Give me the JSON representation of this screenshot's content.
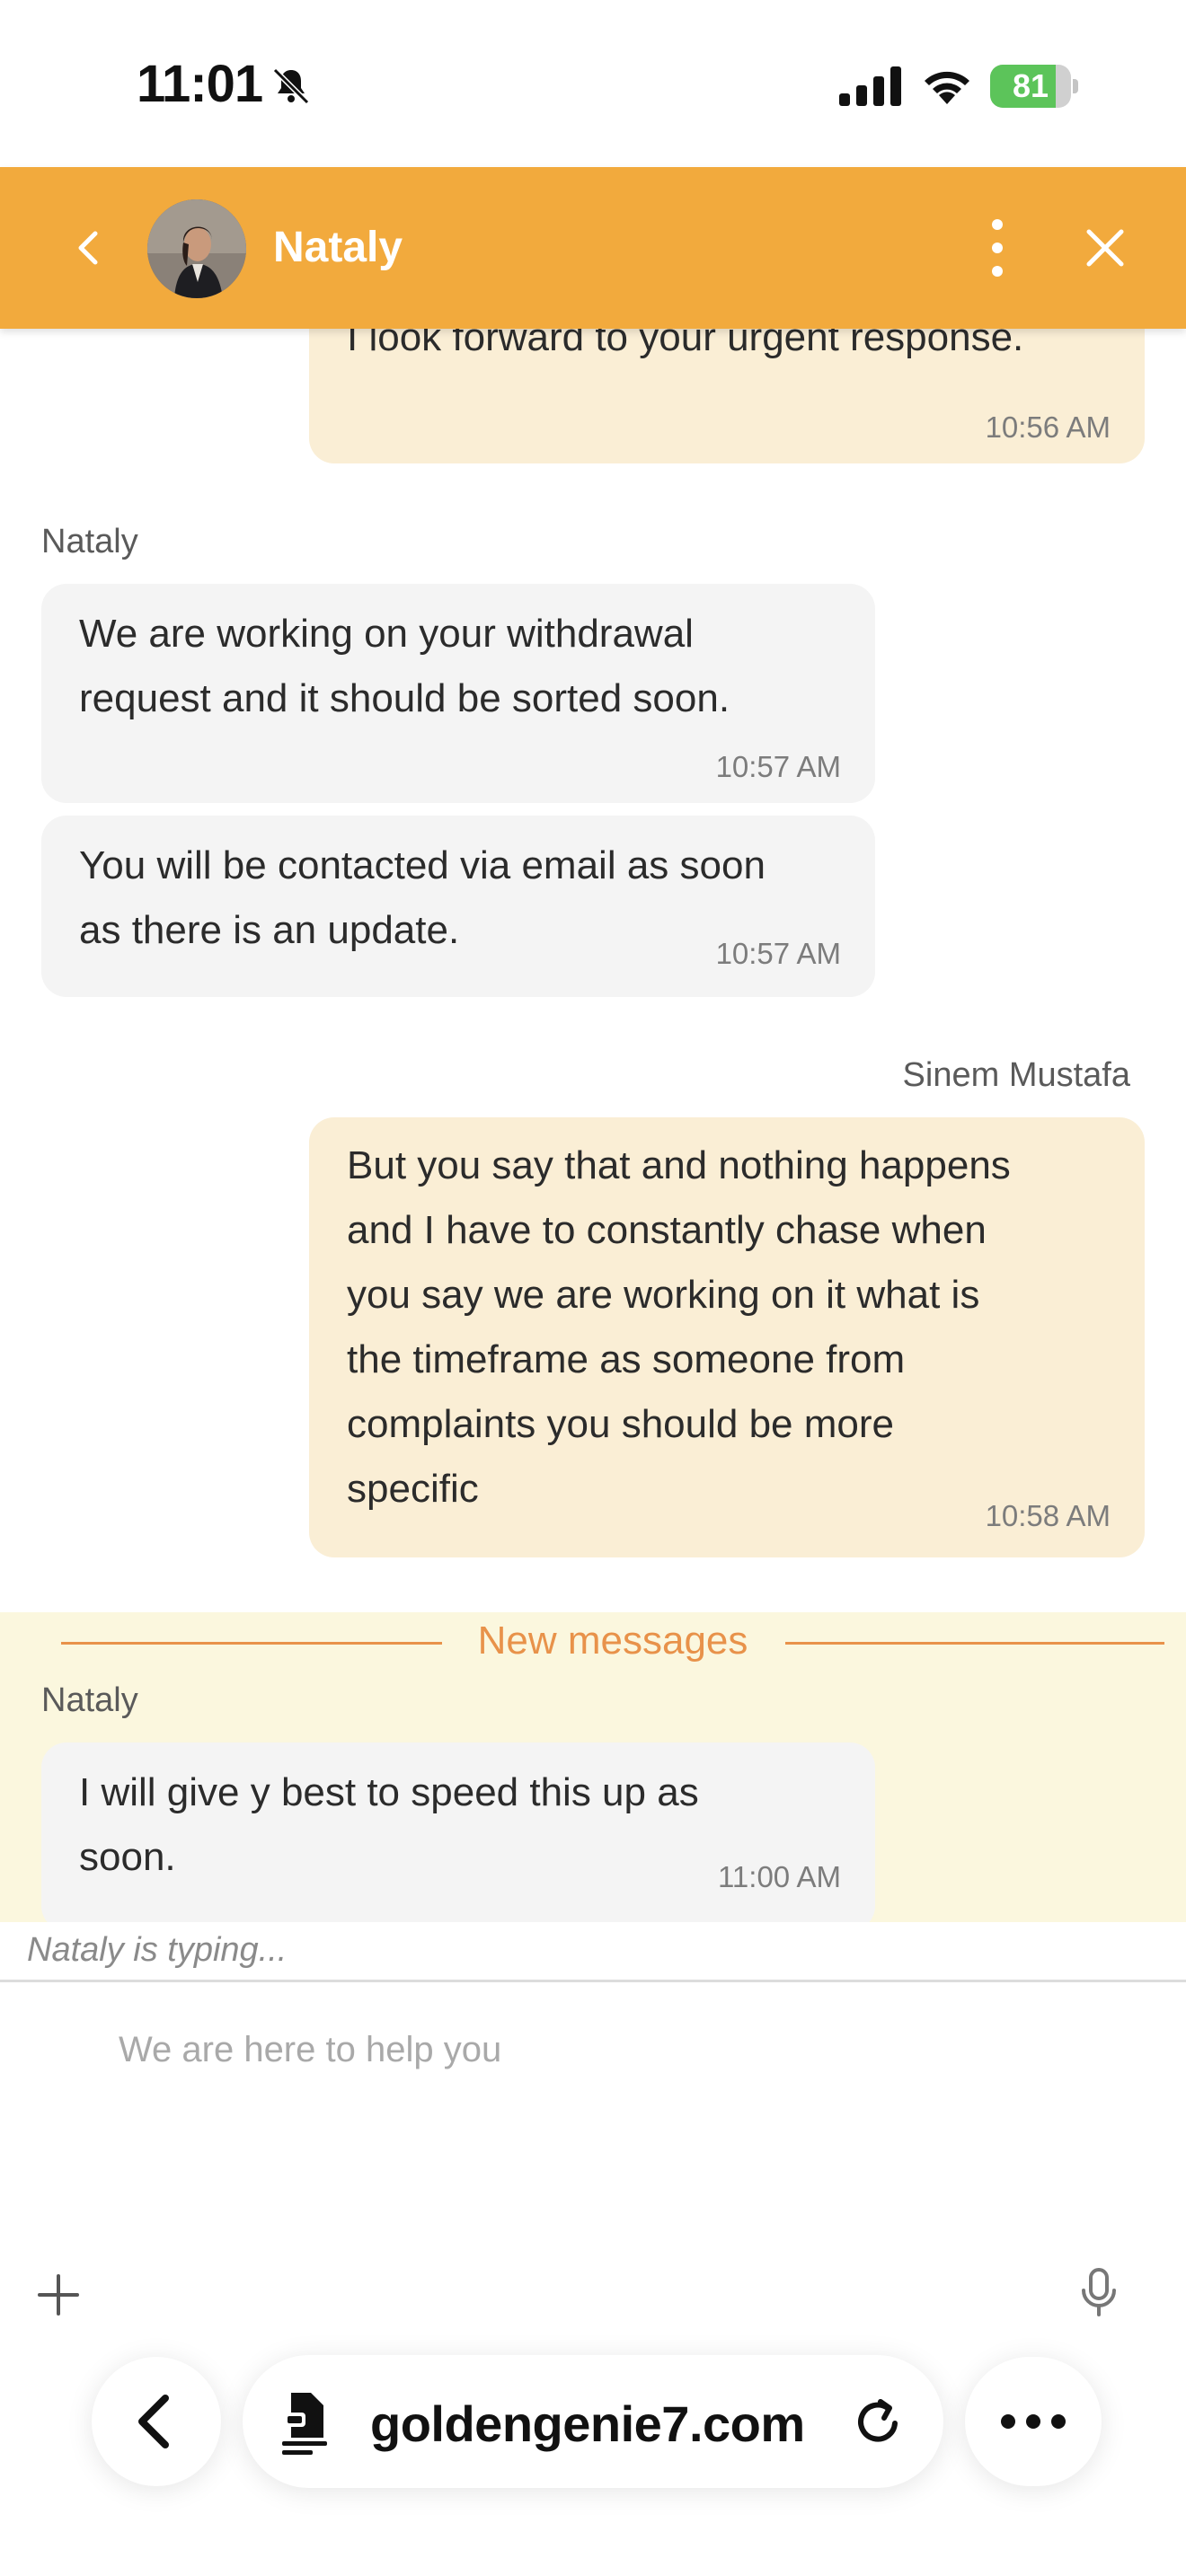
{
  "status_bar": {
    "time": "11:01",
    "battery_level": "81",
    "battery_fraction": 0.81
  },
  "header": {
    "agent_name": "Nataly",
    "icons": [
      "back-chevron-icon",
      "agent-avatar",
      "more-vertical-icon",
      "close-icon"
    ]
  },
  "messages": [
    {
      "direction": "out",
      "text_lines": [
        "I look forward to your urgent response."
      ],
      "time": "10:56 AM"
    },
    {
      "sender": "Nataly"
    },
    {
      "direction": "in",
      "text_lines": [
        "We are working on your withdrawal",
        "request and it should be sorted soon."
      ],
      "time": "10:57 AM"
    },
    {
      "direction": "in",
      "text_lines": [
        "You will be contacted via email as soon",
        "as there is an update."
      ],
      "time": "10:57 AM"
    },
    {
      "sender": "Sinem Mustafa"
    },
    {
      "direction": "out",
      "text_lines": [
        "But you say that and nothing happens",
        "and I have to constantly chase when",
        "you say we are working on it what is",
        "the timeframe as someone from",
        "complaints you should be more",
        "specific"
      ],
      "time": "10:58 AM"
    }
  ],
  "new_messages": {
    "label": "New messages",
    "sender": "Nataly",
    "text_lines": [
      "I will give y best to speed this up as",
      "soon."
    ],
    "time": "11:00 AM"
  },
  "typing_indicator": "Nataly  is typing...",
  "composer": {
    "placeholder": "We are here to help you"
  },
  "browser": {
    "url": "goldengenie7.com"
  },
  "colors": {
    "header": "#f2aa3d",
    "outgoing_bubble": "#faeed5",
    "incoming_bubble": "#f4f4f4",
    "new_messages_band": "#fbf7de",
    "new_messages_accent": "#e8924a"
  }
}
